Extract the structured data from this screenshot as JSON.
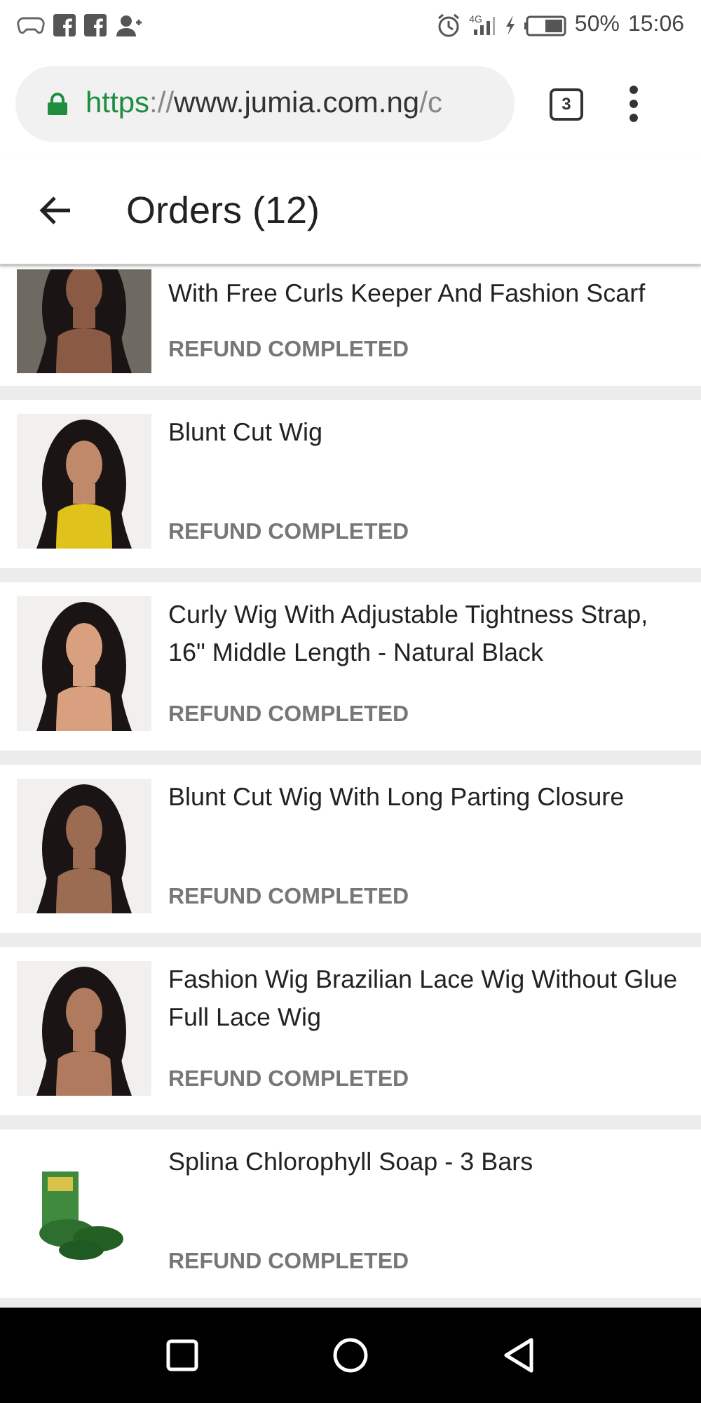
{
  "status_bar": {
    "network": "4G",
    "battery": "50%",
    "time": "15:06"
  },
  "browser": {
    "url": {
      "scheme": "https",
      "separator": "://",
      "host": "www.jumia.com.ng",
      "path": "/c"
    },
    "tab_count": "3"
  },
  "header": {
    "title": "Orders (12)"
  },
  "orders": [
    {
      "title": "With Free Curls Keeper And Fashion Scarf",
      "status": "REFUND COMPLETED",
      "cut": true
    },
    {
      "title": "Blunt Cut Wig",
      "status": "REFUND COMPLETED",
      "cut": false
    },
    {
      "title": "Curly Wig With Adjustable Tightness Strap, 16\" Middle Length - Natural Black",
      "status": "REFUND COMPLETED",
      "cut": false
    },
    {
      "title": "Blunt Cut Wig With Long Parting Closure",
      "status": "REFUND COMPLETED",
      "cut": false
    },
    {
      "title": "Fashion Wig Brazilian Lace Wig Without Glue Full Lace Wig",
      "status": "REFUND COMPLETED",
      "cut": false
    },
    {
      "title": "Splina Chlorophyll Soap - 3 Bars",
      "status": "REFUND COMPLETED",
      "cut": false
    }
  ]
}
